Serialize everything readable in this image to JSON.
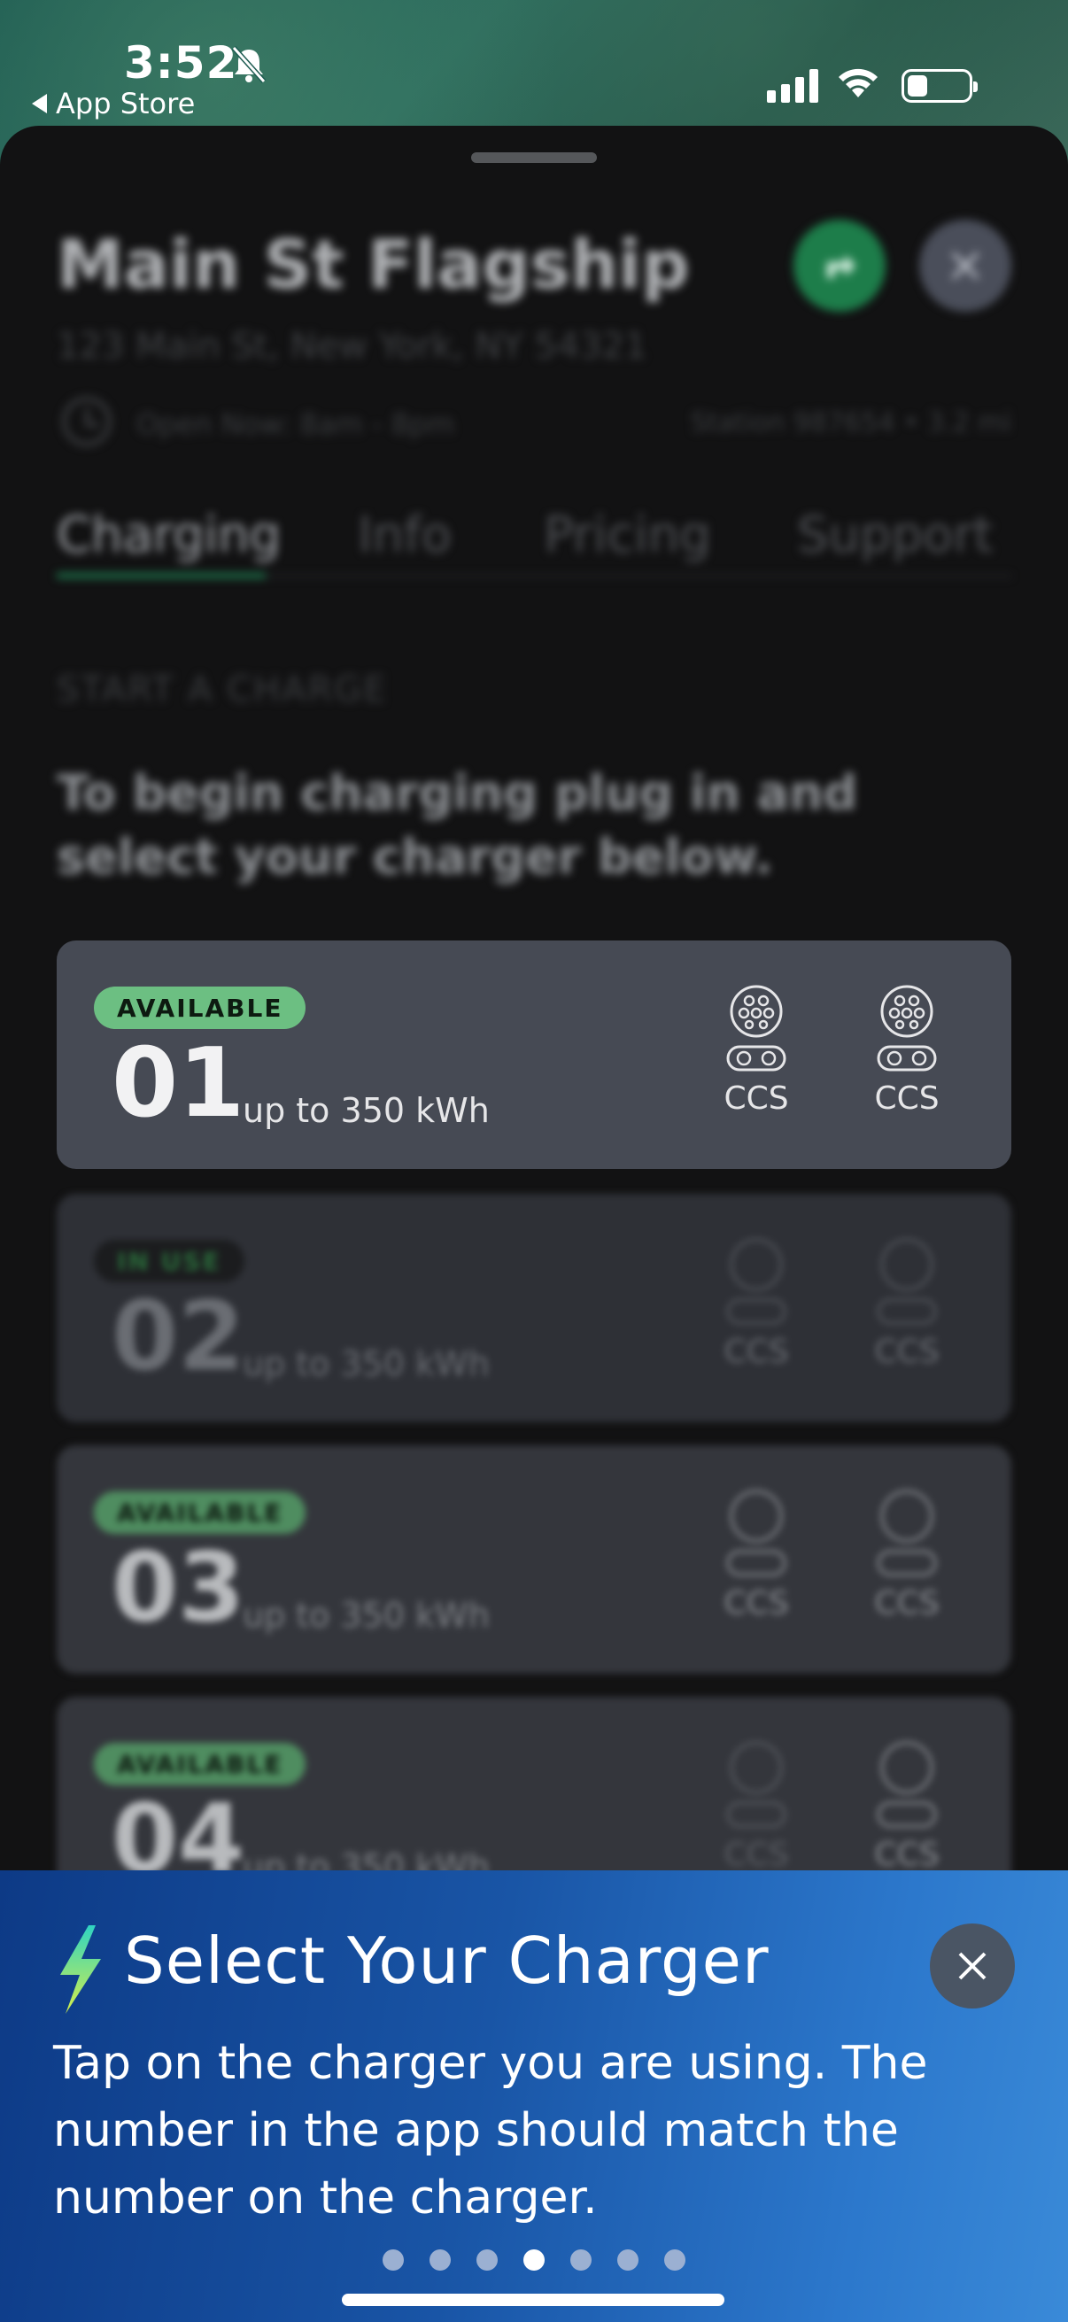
{
  "status_bar": {
    "time": "3:52",
    "back_label": "App Store"
  },
  "station": {
    "name": "Main St Flagship",
    "address": "123 Main St, New York, NY 54321",
    "hours": "Open Now: 8am - 8pm",
    "meta": "Station 987654 • 3.2 mi"
  },
  "tabs": [
    {
      "label": "Charging",
      "active": true
    },
    {
      "label": "Info",
      "active": false
    },
    {
      "label": "Pricing",
      "active": false
    },
    {
      "label": "Support",
      "active": false
    }
  ],
  "section": {
    "label": "START A CHARGE",
    "instructions": "To begin charging plug in and select your charger below."
  },
  "chargers": [
    {
      "status": "AVAILABLE",
      "number": "01",
      "power": "up to 350 kWh",
      "connectors": [
        "CCS",
        "CCS"
      ]
    },
    {
      "status": "IN USE",
      "number": "02",
      "power": "up to 350 kWh",
      "connectors": [
        "CCS",
        "CCS"
      ]
    },
    {
      "status": "AVAILABLE",
      "number": "03",
      "power": "up to 350 kWh",
      "connectors": [
        "CCS",
        "CCS"
      ]
    },
    {
      "status": "AVAILABLE",
      "number": "04",
      "power": "up to 350 kWh",
      "connectors": [
        "CCS",
        "CCS"
      ]
    }
  ],
  "tooltip": {
    "title": "Select Your Charger",
    "body": "Tap on the charger you are using. The number in the app should match the number on the charger.",
    "page_count": 7,
    "active_page": 4
  },
  "colors": {
    "available_badge": "#6cbf82",
    "nav_button": "#1d7d4a",
    "banner_start": "#0d3a86",
    "banner_end": "#3a8ad8"
  },
  "icons": {
    "bell": "bell-slash-icon",
    "directions": "directions-arrow-icon",
    "close": "close-icon",
    "clock": "clock-icon",
    "connector": "ccs-connector-icon",
    "bolt": "lightning-bolt-icon"
  }
}
